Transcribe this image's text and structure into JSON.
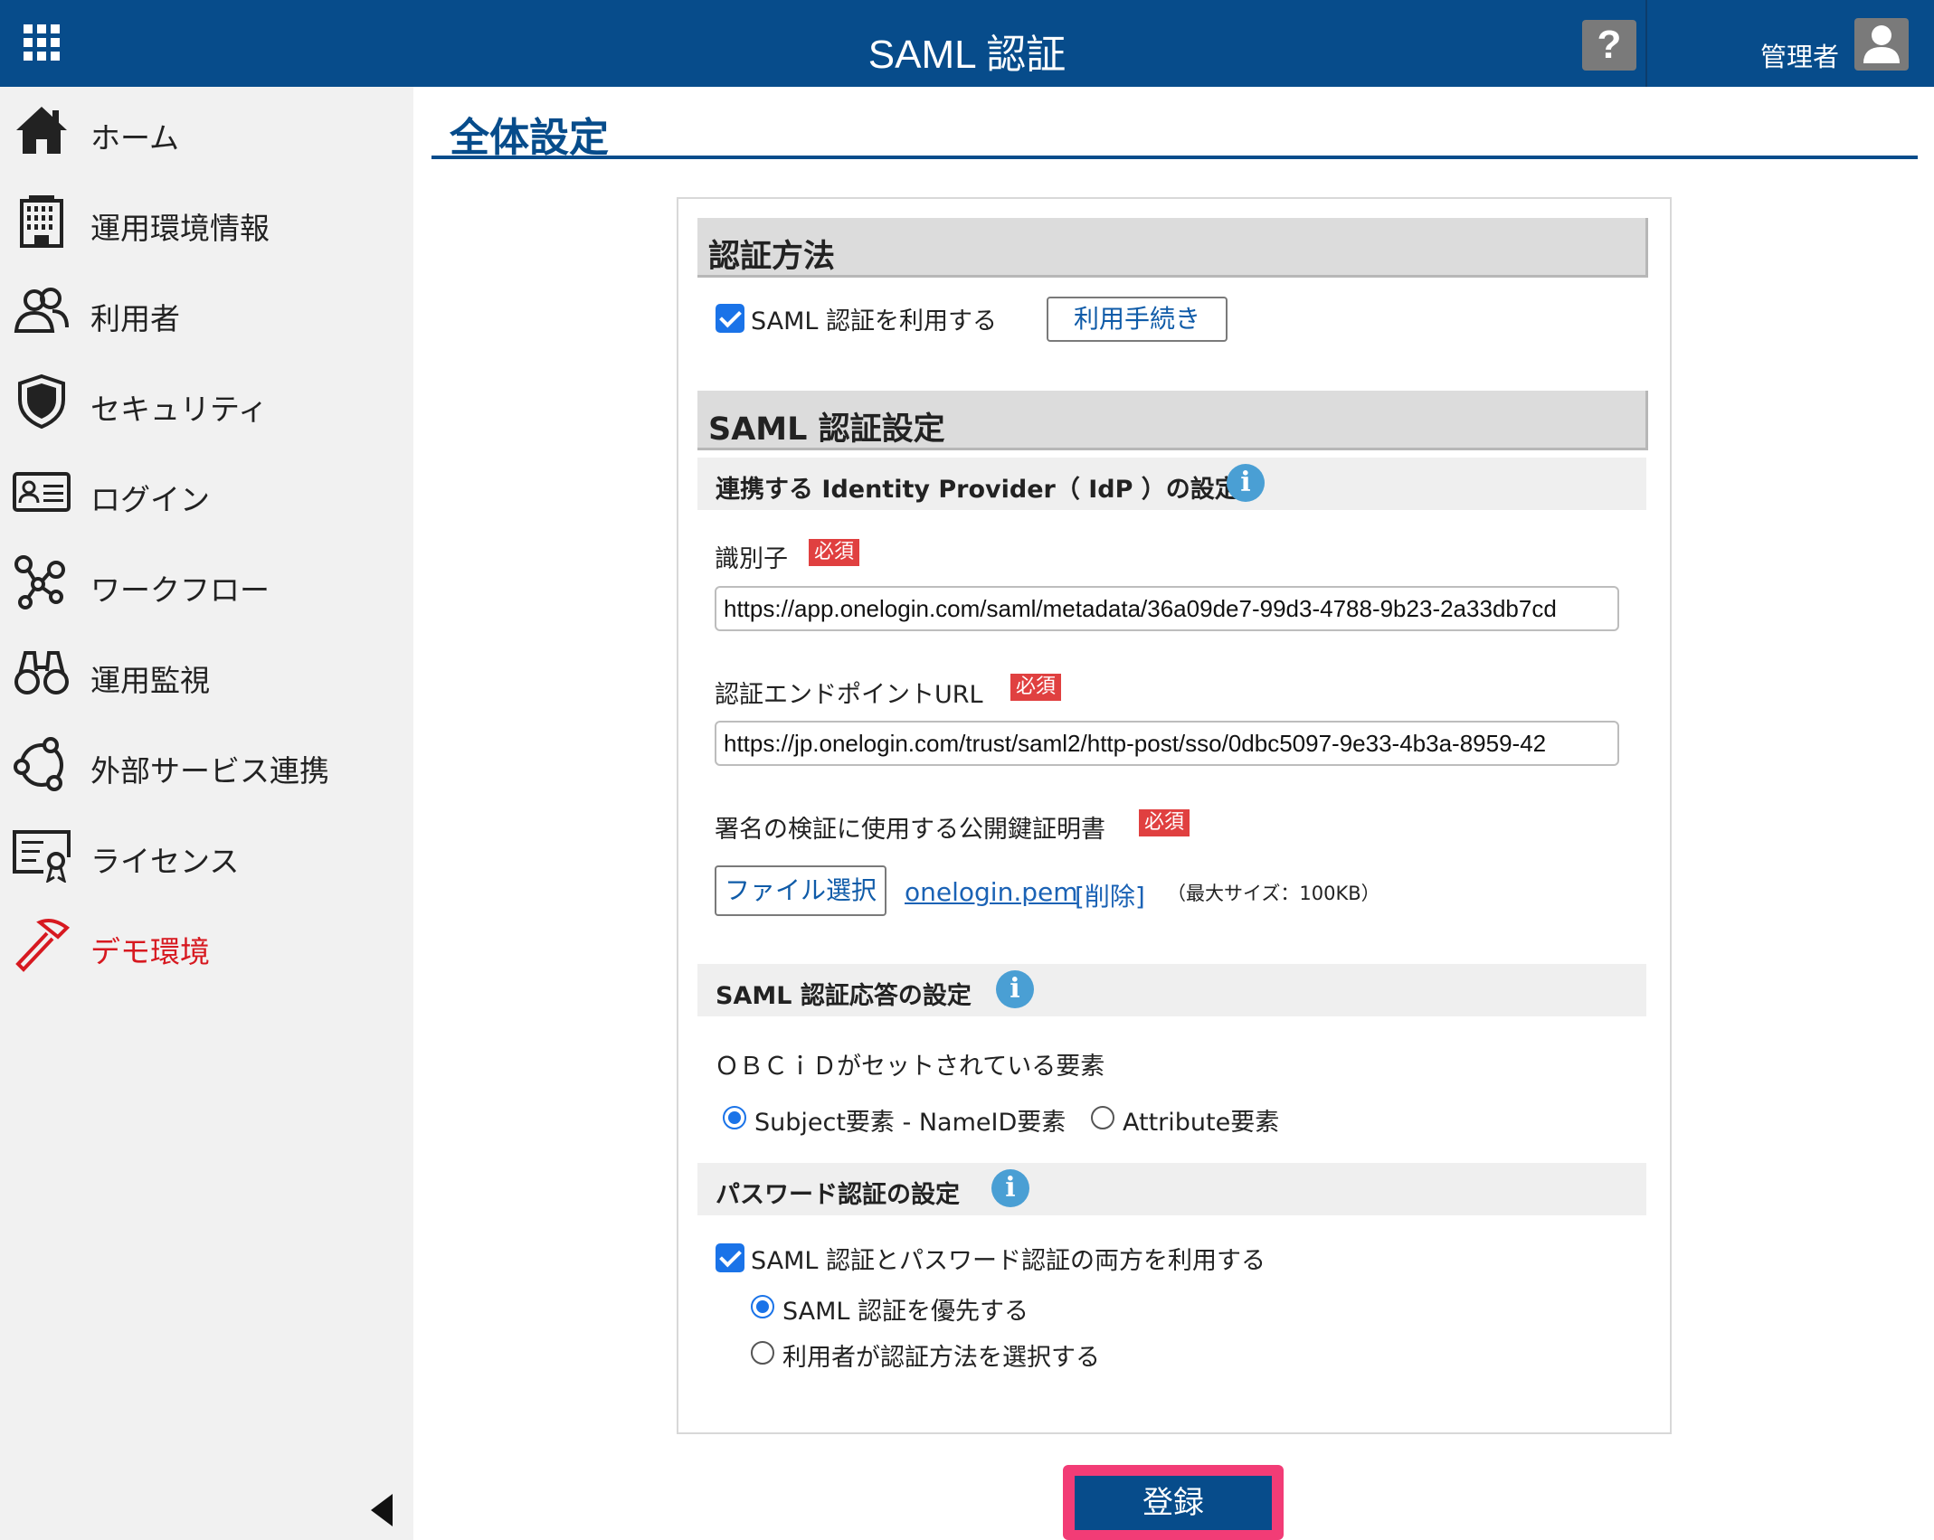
{
  "header": {
    "title": "SAML 認証",
    "help_label": "?",
    "admin_label": "管理者"
  },
  "sidebar": {
    "items": [
      {
        "label": "ホーム",
        "icon": "home-icon"
      },
      {
        "label": "運用環境情報",
        "icon": "building-icon"
      },
      {
        "label": "利用者",
        "icon": "users-icon"
      },
      {
        "label": "セキュリティ",
        "icon": "shield-icon"
      },
      {
        "label": "ログイン",
        "icon": "id-card-icon"
      },
      {
        "label": "ワークフロー",
        "icon": "workflow-icon"
      },
      {
        "label": "運用監視",
        "icon": "binoculars-icon"
      },
      {
        "label": "外部サービス連携",
        "icon": "network-icon"
      },
      {
        "label": "ライセンス",
        "icon": "certificate-icon"
      },
      {
        "label": "デモ環境",
        "icon": "hammer-icon",
        "active": true
      }
    ]
  },
  "page": {
    "title": "全体設定"
  },
  "auth_method": {
    "heading": "認証方法",
    "use_saml_label": "SAML 認証を利用する",
    "use_saml_checked": true,
    "procedure_button": "利用手続き"
  },
  "saml_settings": {
    "heading": "SAML 認証設定",
    "idp_heading": "連携する Identity Provider（ IdP ）の設定",
    "required_badge": "必須",
    "identifier_label": "識別子",
    "identifier_value": "https://app.onelogin.com/saml/metadata/36a09de7-99d3-4788-9b23-2a33db7cd",
    "endpoint_label": "認証エンドポイントURL",
    "endpoint_value": "https://jp.onelogin.com/trust/saml2/http-post/sso/0dbc5097-9e33-4b3a-8959-42",
    "cert_label": "署名の検証に使用する公開鍵証明書",
    "file_button": "ファイル選択",
    "file_name": "onelogin.pem",
    "delete_link": "[削除]",
    "max_size": "（最大サイズ：100KB）"
  },
  "response_settings": {
    "heading": "SAML 認証応答の設定",
    "obc_label": "ＯＢＣｉＤがセットされている要素",
    "options": [
      "Subject要素 - NameID要素",
      "Attribute要素"
    ],
    "selected": 0
  },
  "password_settings": {
    "heading": "パスワード認証の設定",
    "both_label": "SAML 認証とパスワード認証の両方を利用する",
    "both_checked": true,
    "options": [
      "SAML 認証を優先する",
      "利用者が認証方法を選択する"
    ],
    "selected": 0
  },
  "submit_label": "登録",
  "colors": {
    "header_bg": "#074c8b",
    "sidebar_bg": "#f1f1f1",
    "active_nav": "#d71920",
    "required_badge": "#e04040",
    "submit_highlight": "#f23c76"
  }
}
